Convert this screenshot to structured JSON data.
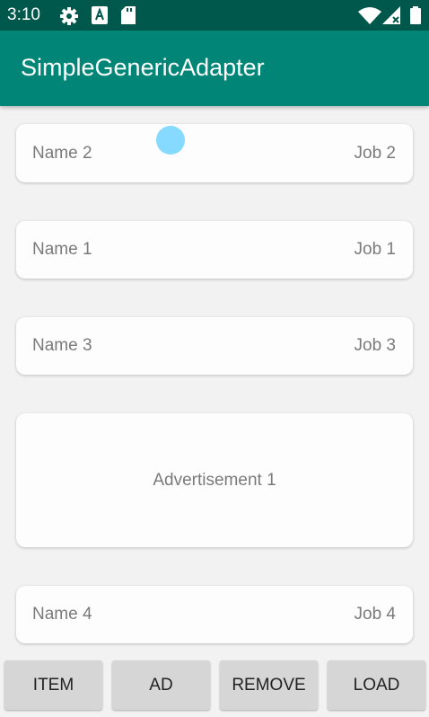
{
  "status_bar": {
    "time": "3:10",
    "icons": [
      "gear-icon",
      "a-letter-icon",
      "sd-card-icon",
      "wifi-icon",
      "signal-icon",
      "battery-icon"
    ]
  },
  "app_bar": {
    "title": "SimpleGenericAdapter"
  },
  "list": {
    "items": [
      {
        "type": "person",
        "name": "Name 2",
        "job": "Job 2"
      },
      {
        "type": "person",
        "name": "Name 1",
        "job": "Job 1"
      },
      {
        "type": "person",
        "name": "Name 3",
        "job": "Job 3"
      },
      {
        "type": "ad",
        "text": "Advertisement 1"
      },
      {
        "type": "person",
        "name": "Name 4",
        "job": "Job 4"
      }
    ]
  },
  "buttons": {
    "item": "ITEM",
    "ad": "AD",
    "remove": "REMOVE",
    "load": "LOAD"
  },
  "colors": {
    "status_bar": "#00574b",
    "app_bar": "#008577",
    "touch_indicator": "#80d8ff"
  }
}
